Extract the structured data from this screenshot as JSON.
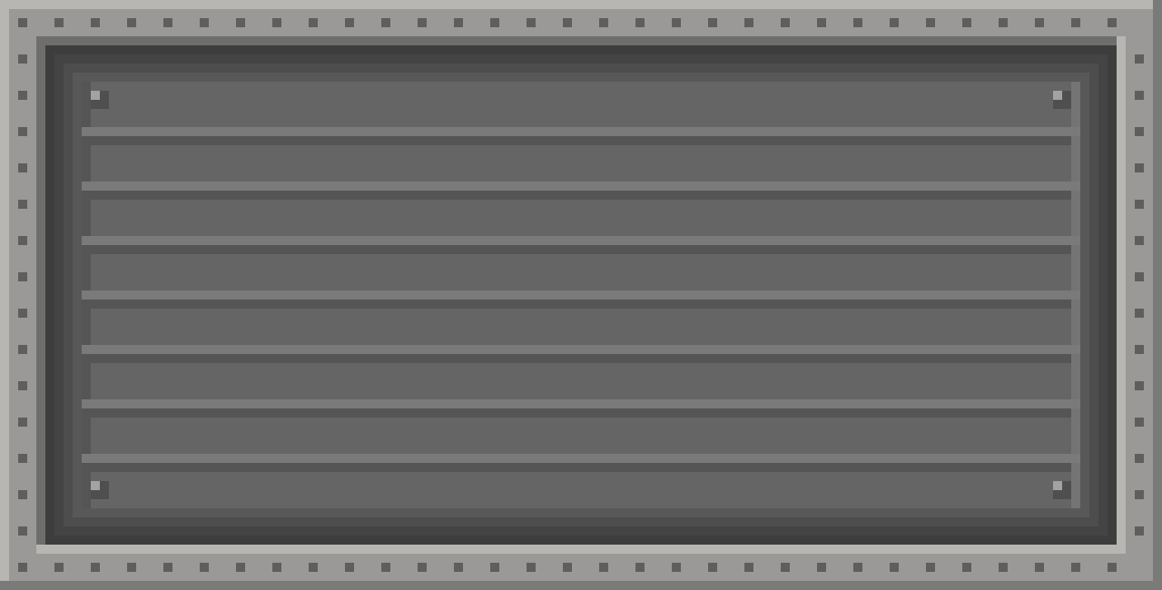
{
  "panel": {
    "slat_count": 8,
    "palette": {
      "frame_light": "#b8b6b3",
      "frame": "#9a9997",
      "frame_shadow": "#7a7a78",
      "rivet": "#5e5e5c",
      "panel_deep": "#3d3d3d",
      "slat": "#656565",
      "slat_shadow": "#555555",
      "slat_highlight": "#7a7a7a",
      "bolt": "#4f4f4f",
      "bolt_shine": "#a3a3a3"
    },
    "icons": {
      "rivet": "rivet-icon",
      "bolt": "bolt-icon"
    }
  }
}
